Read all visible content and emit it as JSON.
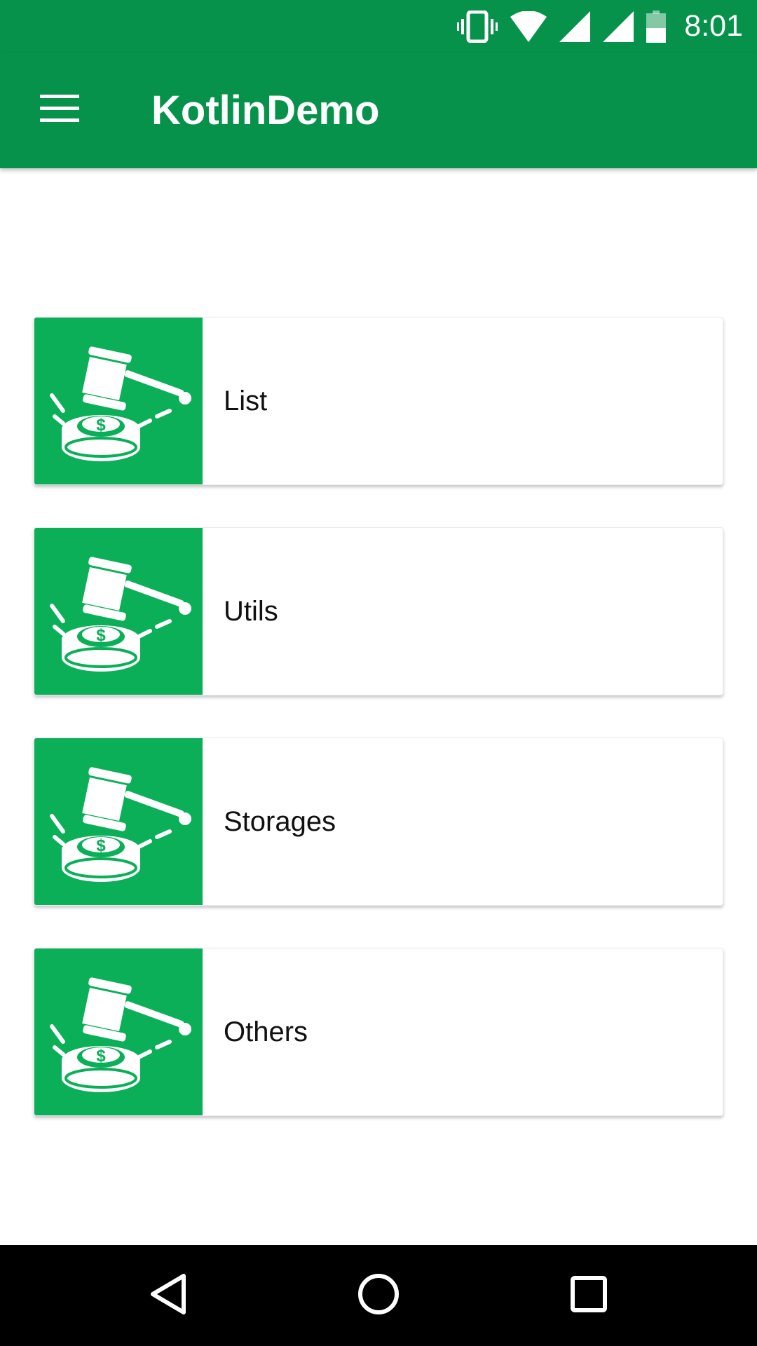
{
  "status_bar": {
    "time": "8:01",
    "icons": [
      "vibrate-icon",
      "wifi-icon",
      "cellular-signal-icon",
      "cellular-signal-icon",
      "battery-icon"
    ]
  },
  "app_bar": {
    "title": "KotlinDemo",
    "menu_icon": "hamburger-menu-icon"
  },
  "menu_items": [
    {
      "label": "List",
      "icon": "gavel-coin-icon"
    },
    {
      "label": "Utils",
      "icon": "gavel-coin-icon"
    },
    {
      "label": "Storages",
      "icon": "gavel-coin-icon"
    },
    {
      "label": "Others",
      "icon": "gavel-coin-icon"
    }
  ],
  "nav_bar": {
    "back_icon": "back-triangle-icon",
    "home_icon": "home-circle-icon",
    "recents_icon": "recents-square-icon"
  },
  "colors": {
    "primary": "#07924b",
    "icon_bg": "#0aaf58",
    "nav_bar": "#000000"
  }
}
